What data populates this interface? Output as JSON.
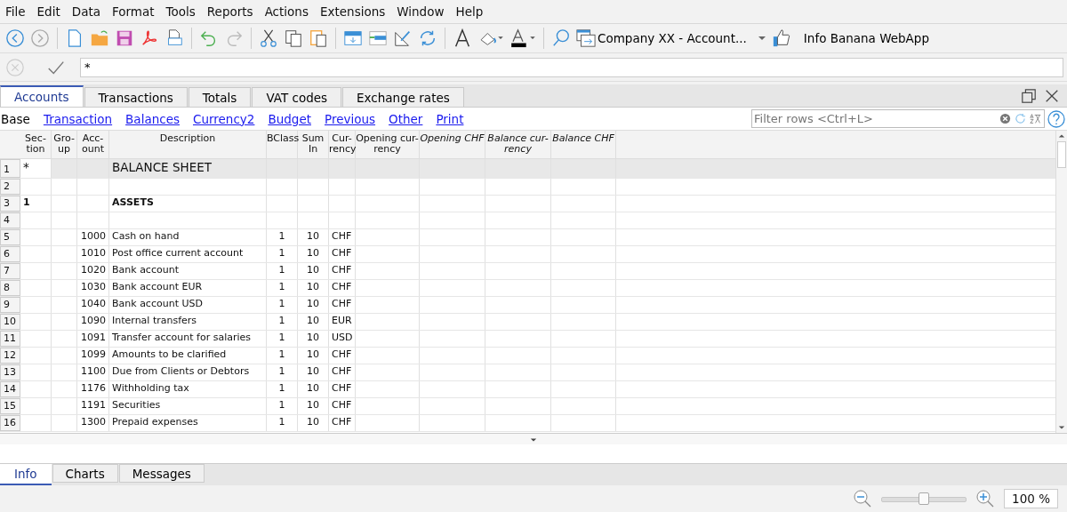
{
  "menu": [
    "File",
    "Edit",
    "Data",
    "Format",
    "Tools",
    "Reports",
    "Actions",
    "Extensions",
    "Window",
    "Help"
  ],
  "toolbar": {
    "file_selector": "Company XX - Account...",
    "info_button": "Info Banana WebApp"
  },
  "edit_bar": {
    "value": "*"
  },
  "tabs": [
    {
      "label": "Accounts",
      "selected": true
    },
    {
      "label": "Transactions",
      "selected": false
    },
    {
      "label": "Totals",
      "selected": false
    },
    {
      "label": "VAT codes",
      "selected": false
    },
    {
      "label": "Exchange rates",
      "selected": false
    }
  ],
  "views": [
    {
      "label": "Base",
      "selected": true
    },
    {
      "label": "Transaction",
      "selected": false
    },
    {
      "label": "Balances",
      "selected": false
    },
    {
      "label": "Currency2",
      "selected": false
    },
    {
      "label": "Budget",
      "selected": false
    },
    {
      "label": "Previous",
      "selected": false
    },
    {
      "label": "Other",
      "selected": false
    },
    {
      "label": "Print",
      "selected": false
    }
  ],
  "filter": {
    "placeholder": "Filter rows <Ctrl+L>"
  },
  "table": {
    "columns": [
      {
        "lines": [
          "Sec-",
          "tion"
        ],
        "italic": false
      },
      {
        "lines": [
          "Gro-",
          "up"
        ],
        "italic": false
      },
      {
        "lines": [
          "Acc-",
          "ount"
        ],
        "italic": false
      },
      {
        "lines": [
          "Description"
        ],
        "italic": false
      },
      {
        "lines": [
          "BClass"
        ],
        "italic": false
      },
      {
        "lines": [
          "Sum",
          "In"
        ],
        "italic": false
      },
      {
        "lines": [
          "Cur-",
          "rency"
        ],
        "italic": false
      },
      {
        "lines": [
          "Opening cur-",
          "rency"
        ],
        "italic": false
      },
      {
        "lines": [
          "Opening CHF"
        ],
        "italic": true
      },
      {
        "lines": [
          "Balance cur-",
          "rency"
        ],
        "italic": true
      },
      {
        "lines": [
          "Balance CHF"
        ],
        "italic": true
      }
    ],
    "rows": [
      {
        "number": "1",
        "kind": "title",
        "cells": [
          "*",
          "",
          "",
          "BALANCE SHEET",
          "",
          "",
          "",
          "",
          "",
          "",
          ""
        ]
      },
      {
        "number": "2",
        "kind": "plain",
        "cells": [
          "",
          "",
          "",
          "",
          "",
          "",
          "",
          "",
          "",
          "",
          ""
        ]
      },
      {
        "number": "3",
        "kind": "heading",
        "cells": [
          "1",
          "",
          "",
          "ASSETS",
          "",
          "",
          "",
          "",
          "",
          "",
          ""
        ]
      },
      {
        "number": "4",
        "kind": "plain",
        "cells": [
          "",
          "",
          "",
          "",
          "",
          "",
          "",
          "",
          "",
          "",
          ""
        ]
      },
      {
        "number": "5",
        "kind": "plain",
        "cells": [
          "",
          "",
          "1000",
          "Cash on hand",
          "1",
          "10",
          "CHF",
          "",
          "",
          "",
          ""
        ]
      },
      {
        "number": "6",
        "kind": "plain",
        "cells": [
          "",
          "",
          "1010",
          "Post office current account",
          "1",
          "10",
          "CHF",
          "",
          "",
          "",
          ""
        ]
      },
      {
        "number": "7",
        "kind": "plain",
        "cells": [
          "",
          "",
          "1020",
          "Bank account",
          "1",
          "10",
          "CHF",
          "",
          "",
          "",
          ""
        ]
      },
      {
        "number": "8",
        "kind": "plain",
        "cells": [
          "",
          "",
          "1030",
          "Bank account EUR",
          "1",
          "10",
          "CHF",
          "",
          "",
          "",
          ""
        ]
      },
      {
        "number": "9",
        "kind": "plain",
        "cells": [
          "",
          "",
          "1040",
          "Bank account USD",
          "1",
          "10",
          "CHF",
          "",
          "",
          "",
          ""
        ]
      },
      {
        "number": "10",
        "kind": "plain",
        "cells": [
          "",
          "",
          "1090",
          "Internal transfers",
          "1",
          "10",
          "EUR",
          "",
          "",
          "",
          ""
        ]
      },
      {
        "number": "11",
        "kind": "plain",
        "cells": [
          "",
          "",
          "1091",
          "Transfer account for salaries",
          "1",
          "10",
          "USD",
          "",
          "",
          "",
          ""
        ]
      },
      {
        "number": "12",
        "kind": "plain",
        "cells": [
          "",
          "",
          "1099",
          "Amounts to be clarified",
          "1",
          "10",
          "CHF",
          "",
          "",
          "",
          ""
        ]
      },
      {
        "number": "13",
        "kind": "plain",
        "cells": [
          "",
          "",
          "1100",
          "Due from Clients or Debtors",
          "1",
          "10",
          "CHF",
          "",
          "",
          "",
          ""
        ]
      },
      {
        "number": "14",
        "kind": "plain",
        "cells": [
          "",
          "",
          "1176",
          "Withholding tax",
          "1",
          "10",
          "CHF",
          "",
          "",
          "",
          ""
        ]
      },
      {
        "number": "15",
        "kind": "plain",
        "cells": [
          "",
          "",
          "1191",
          "Securities",
          "1",
          "10",
          "CHF",
          "",
          "",
          "",
          ""
        ]
      },
      {
        "number": "16",
        "kind": "plain",
        "cells": [
          "",
          "",
          "1300",
          "Prepaid expenses",
          "1",
          "10",
          "CHF",
          "",
          "",
          "",
          ""
        ]
      }
    ]
  },
  "bottom_tabs": [
    {
      "label": "Info",
      "selected": true
    },
    {
      "label": "Charts",
      "selected": false
    },
    {
      "label": "Messages",
      "selected": false
    }
  ],
  "zoom": {
    "level": 0.5,
    "value": "100 %"
  }
}
